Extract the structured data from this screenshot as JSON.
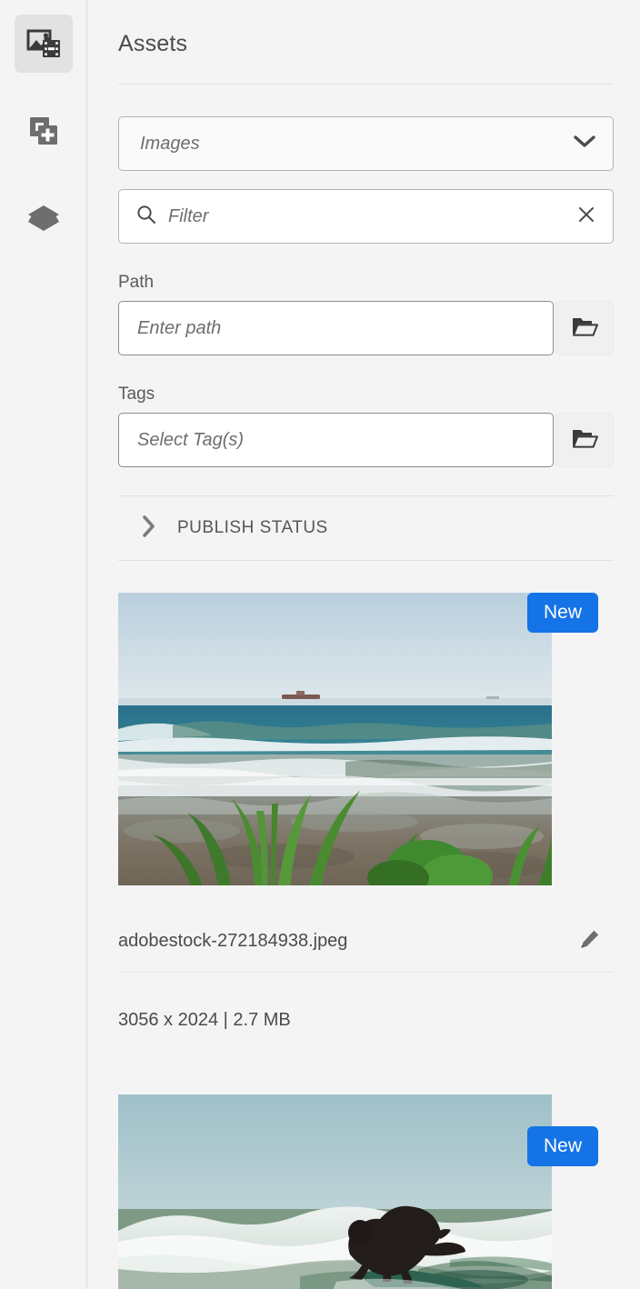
{
  "rail": {
    "items": [
      {
        "name": "assets-media",
        "icon": "image-film-icon",
        "active": true
      },
      {
        "name": "add-component",
        "icon": "add-duplicate-icon",
        "active": false
      },
      {
        "name": "layers",
        "icon": "layers-icon",
        "active": false
      }
    ]
  },
  "panel": {
    "title": "Assets"
  },
  "type_select": {
    "value": "Images",
    "icon": "chevron-down-icon"
  },
  "filter": {
    "placeholder": "Filter",
    "value": "",
    "search_icon": "search-icon",
    "clear_icon": "close-icon"
  },
  "path": {
    "label": "Path",
    "placeholder": "Enter path",
    "value": "",
    "browse_icon": "folder-open-icon"
  },
  "tags": {
    "label": "Tags",
    "placeholder": "Select Tag(s)",
    "value": "",
    "browse_icon": "folder-open-icon"
  },
  "publish_status": {
    "label": "PUBLISH STATUS",
    "expanded": false,
    "icon": "chevron-right-icon"
  },
  "assets": [
    {
      "badge": "New",
      "filename": "adobestock-272184938.jpeg",
      "dimensions": "3056 x 2024",
      "filesize": "2.7 MB",
      "meta": "3056 x 2024 | 2.7 MB",
      "edit_icon": "pencil-icon",
      "thumbnail": "beach-shoreline-waves-photo"
    },
    {
      "badge": "New",
      "filename": "",
      "dimensions": "",
      "filesize": "",
      "meta": "",
      "edit_icon": "pencil-icon",
      "thumbnail": "surfer-riding-wave-photo"
    }
  ],
  "colors": {
    "accent_blue": "#1473E6",
    "panel_bg": "#F4F4F4",
    "rail_active": "#E2E2E2",
    "text": "#4B4B4B",
    "muted_text": "#6E6E6E",
    "divider": "#E0E0E0"
  }
}
